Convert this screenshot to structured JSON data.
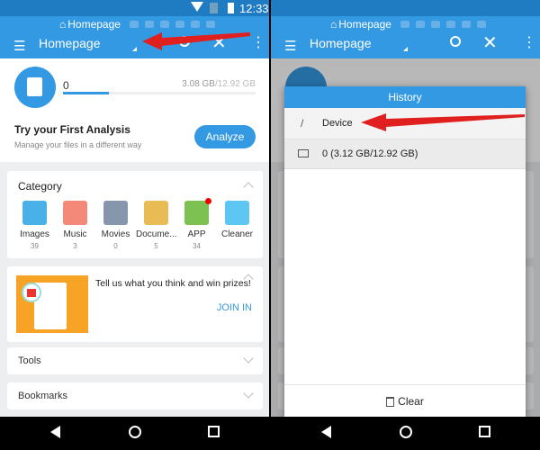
{
  "status": {
    "time": "12:33"
  },
  "appbar": {
    "breadcrumb": "Homepage",
    "title": "Homepage"
  },
  "storage": {
    "name": "0",
    "used": "3.08 GB",
    "total": "/12.92 GB",
    "used_fraction": 0.24
  },
  "analysis": {
    "title": "Try your First Analysis",
    "subtitle": "Manage your files in a different way",
    "button": "Analyze"
  },
  "category": {
    "title": "Category",
    "items": [
      {
        "label": "Images",
        "count": "39",
        "color": "#4ab0e8"
      },
      {
        "label": "Music",
        "count": "3",
        "color": "#f4897a"
      },
      {
        "label": "Movies",
        "count": "0",
        "color": "#8696ad"
      },
      {
        "label": "Docume...",
        "count": "5",
        "color": "#e8bb55"
      },
      {
        "label": "APP",
        "count": "34",
        "color": "#7cc152"
      },
      {
        "label": "Cleaner",
        "count": "",
        "color": "#5ec6f2"
      }
    ]
  },
  "promo": {
    "text": "Tell us what you think and win prizes!",
    "button": "JOIN IN"
  },
  "tools": {
    "title": "Tools"
  },
  "bookmarks": {
    "title": "Bookmarks"
  },
  "history": {
    "title": "History",
    "items": [
      {
        "label": "Device",
        "icon": "slash"
      },
      {
        "label": "0 (3.12 GB/12.92 GB)",
        "icon": "storage"
      }
    ],
    "clear": "Clear"
  },
  "colors": {
    "primary": "#3399e3",
    "accent_red": "#e0201e"
  }
}
